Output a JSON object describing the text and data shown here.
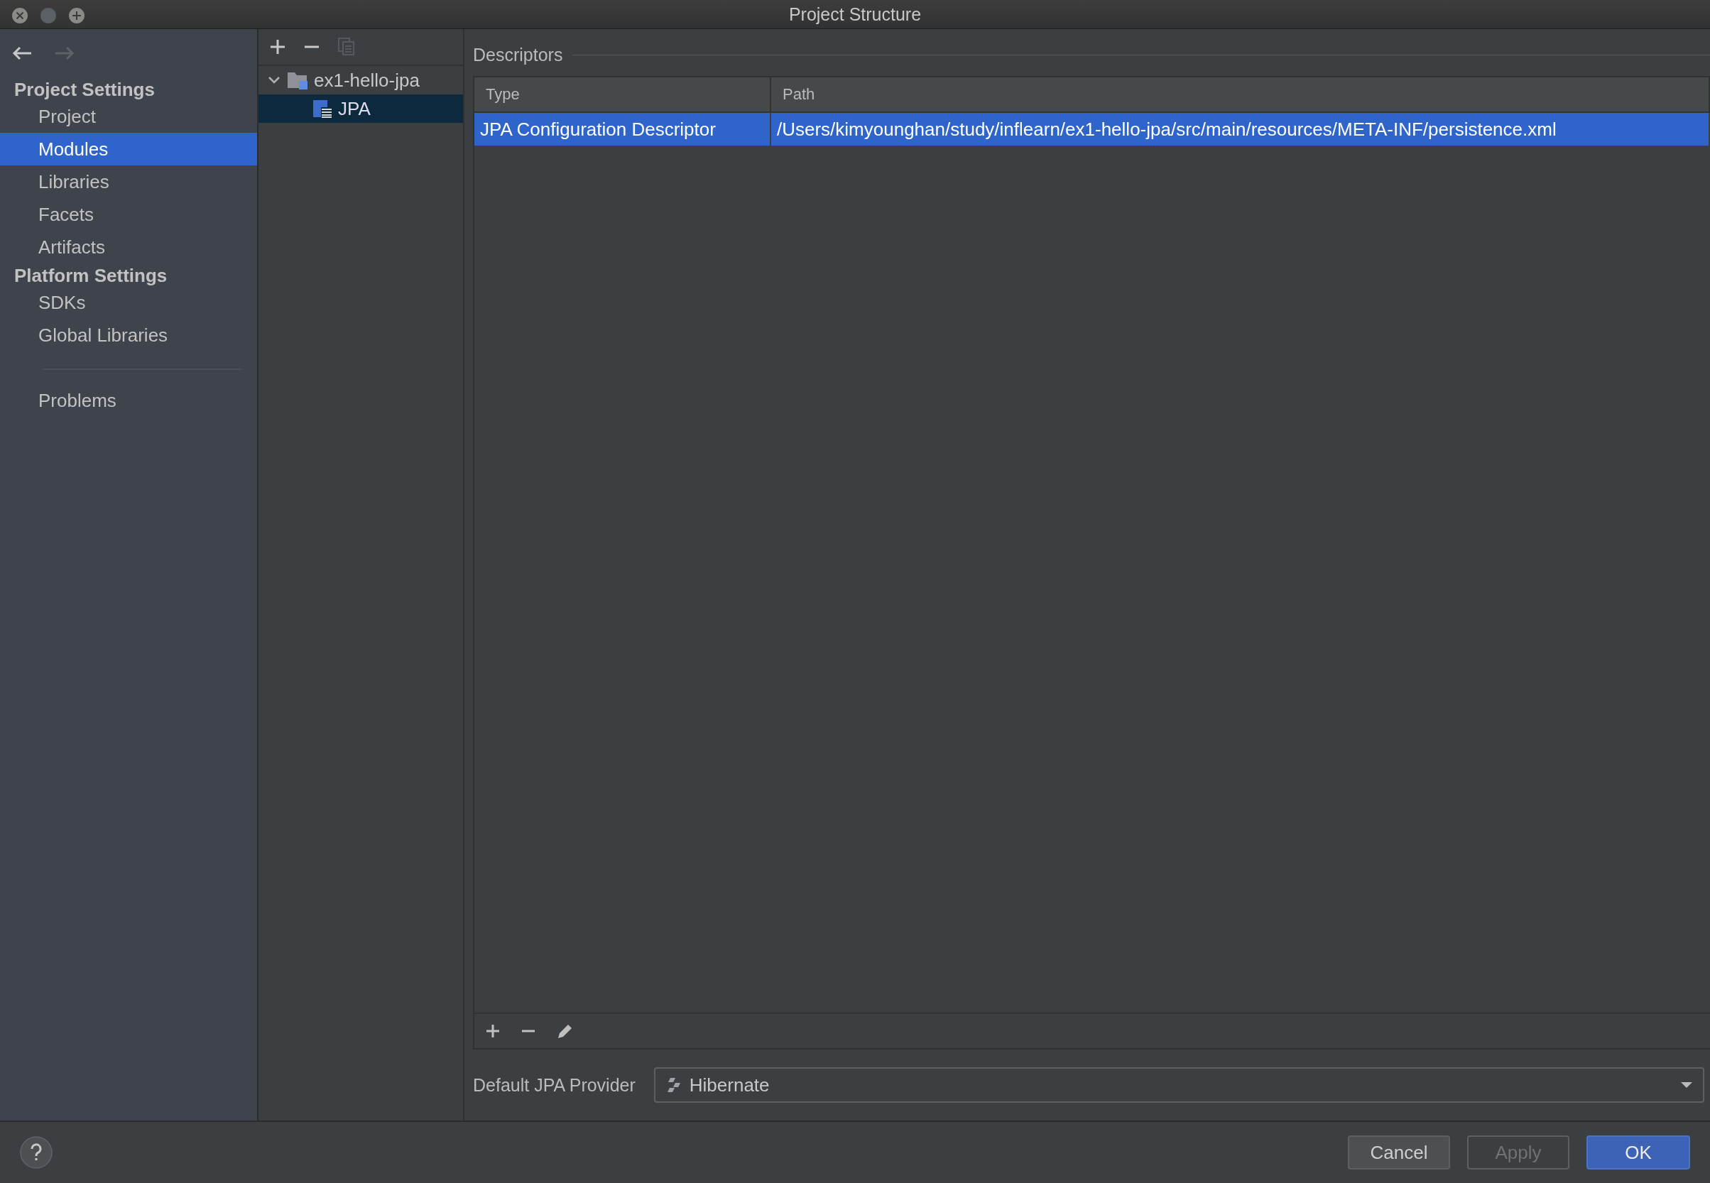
{
  "window": {
    "title": "Project Structure"
  },
  "sidebar": {
    "groups": [
      {
        "heading": "Project Settings",
        "items": [
          {
            "label": "Project",
            "selected": false
          },
          {
            "label": "Modules",
            "selected": true
          },
          {
            "label": "Libraries",
            "selected": false
          },
          {
            "label": "Facets",
            "selected": false
          },
          {
            "label": "Artifacts",
            "selected": false
          }
        ]
      },
      {
        "heading": "Platform Settings",
        "items": [
          {
            "label": "SDKs",
            "selected": false
          },
          {
            "label": "Global Libraries",
            "selected": false
          }
        ]
      }
    ],
    "extra_items": [
      {
        "label": "Problems",
        "selected": false
      }
    ]
  },
  "tree": [
    {
      "label": "ex1-hello-jpa",
      "kind": "module",
      "expanded": true,
      "selected": false,
      "children": [
        {
          "label": "JPA",
          "kind": "facet",
          "selected": true
        }
      ]
    }
  ],
  "descriptors": {
    "title": "Descriptors",
    "columns": [
      "Type",
      "Path"
    ],
    "rows": [
      {
        "cells": [
          "JPA Configuration Descriptor",
          "/Users/kimyounghan/study/inflearn/ex1-hello-jpa/src/main/resources/META-INF/persistence.xml"
        ],
        "selected": true
      }
    ]
  },
  "provider": {
    "label": "Default JPA Provider",
    "value": "Hibernate"
  },
  "buttons": [
    {
      "label": "Cancel",
      "disabled": false,
      "default": false
    },
    {
      "label": "Apply",
      "disabled": true,
      "default": false
    },
    {
      "label": "OK",
      "disabled": false,
      "default": true
    }
  ]
}
